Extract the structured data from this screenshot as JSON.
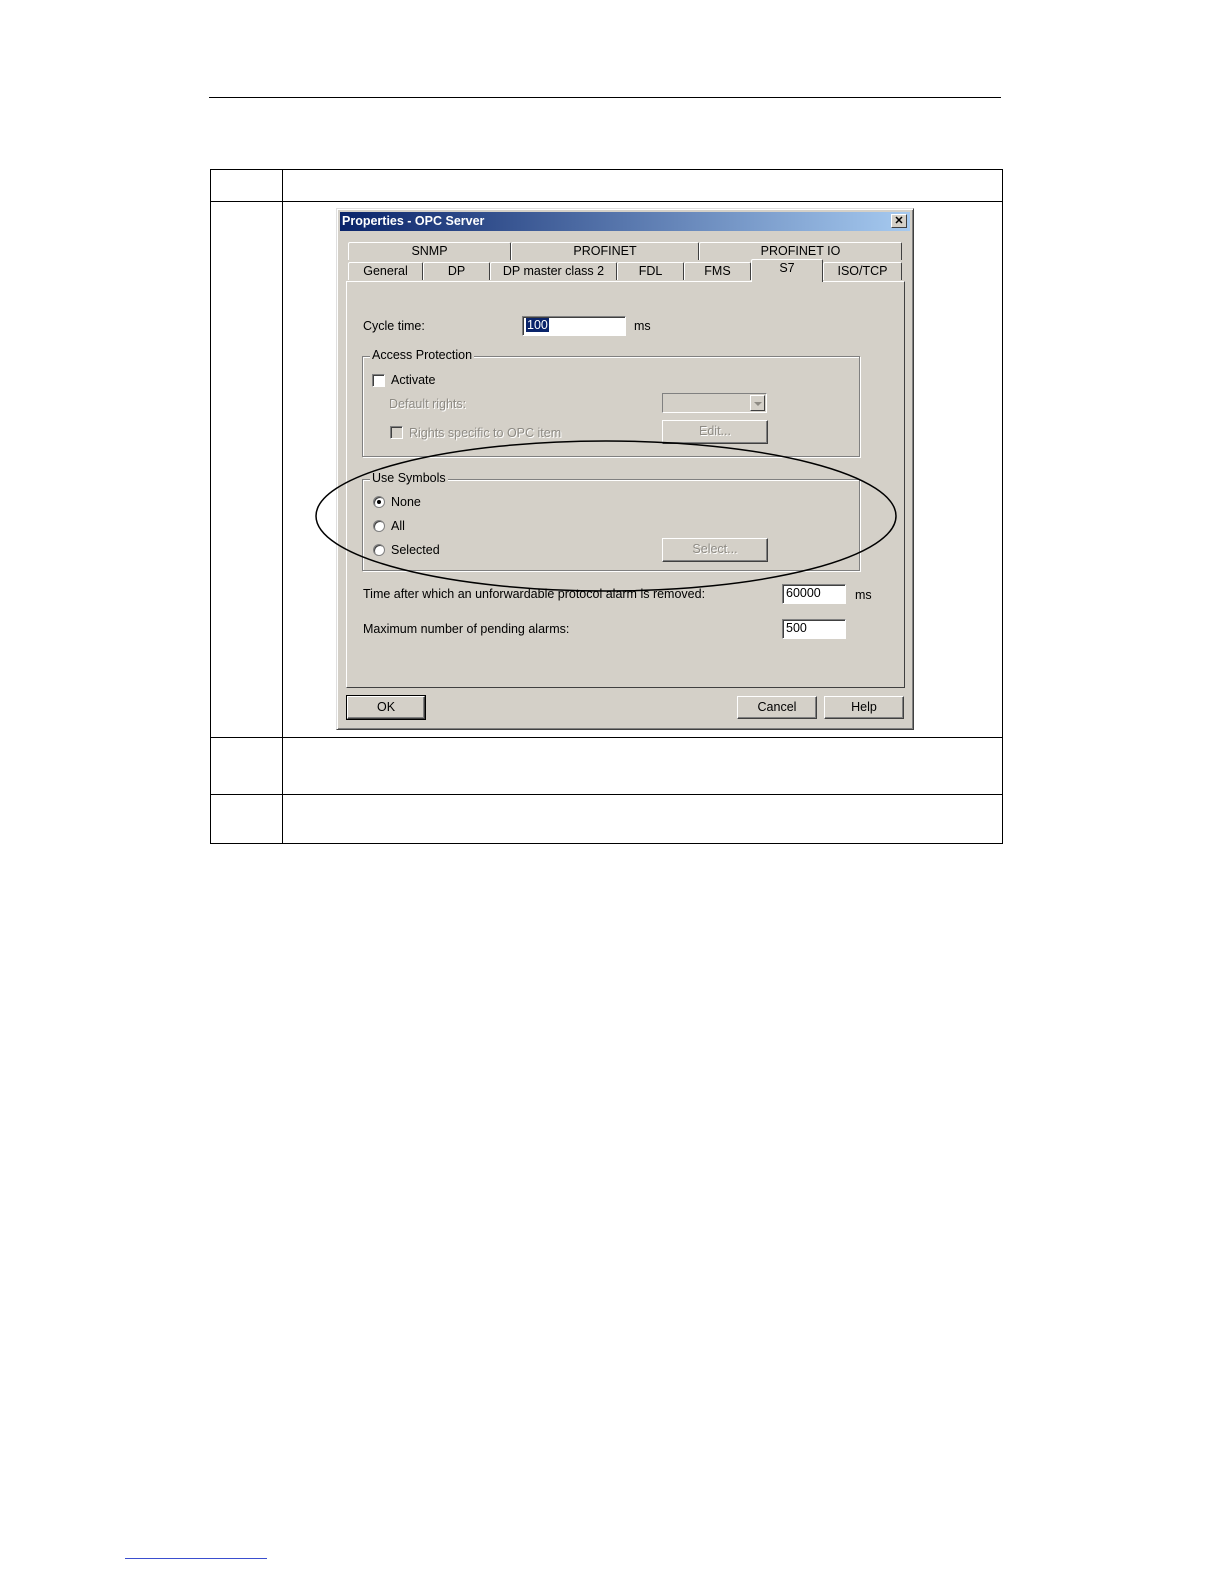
{
  "dialog": {
    "title": "Properties - OPC Server",
    "close_glyph": "✕",
    "tabs_row1": [
      "SNMP",
      "PROFINET",
      "PROFINET IO"
    ],
    "tabs_row2": [
      "General",
      "DP",
      "DP master class 2",
      "FDL",
      "FMS",
      "S7",
      "ISO/TCP"
    ],
    "active_tab": "S7",
    "cycle_time": {
      "label": "Cycle time:",
      "value": "100",
      "unit": "ms"
    },
    "access_protection": {
      "title": "Access Protection",
      "activate_label": "Activate",
      "activate_checked": false,
      "default_rights_label": "Default rights:",
      "rights_specific_label": "Rights specific to OPC item",
      "edit_button": "Edit..."
    },
    "use_symbols": {
      "title": "Use Symbols",
      "options": [
        "None",
        "All",
        "Selected"
      ],
      "selected": "None",
      "select_button": "Select..."
    },
    "alarm_removal": {
      "label": "Time after which an unforwardable protocol alarm is removed:",
      "value": "60000",
      "unit": "ms"
    },
    "max_pending": {
      "label": "Maximum number of pending alarms:",
      "value": "500"
    },
    "buttons": {
      "ok": "OK",
      "cancel": "Cancel",
      "help": "Help"
    }
  }
}
